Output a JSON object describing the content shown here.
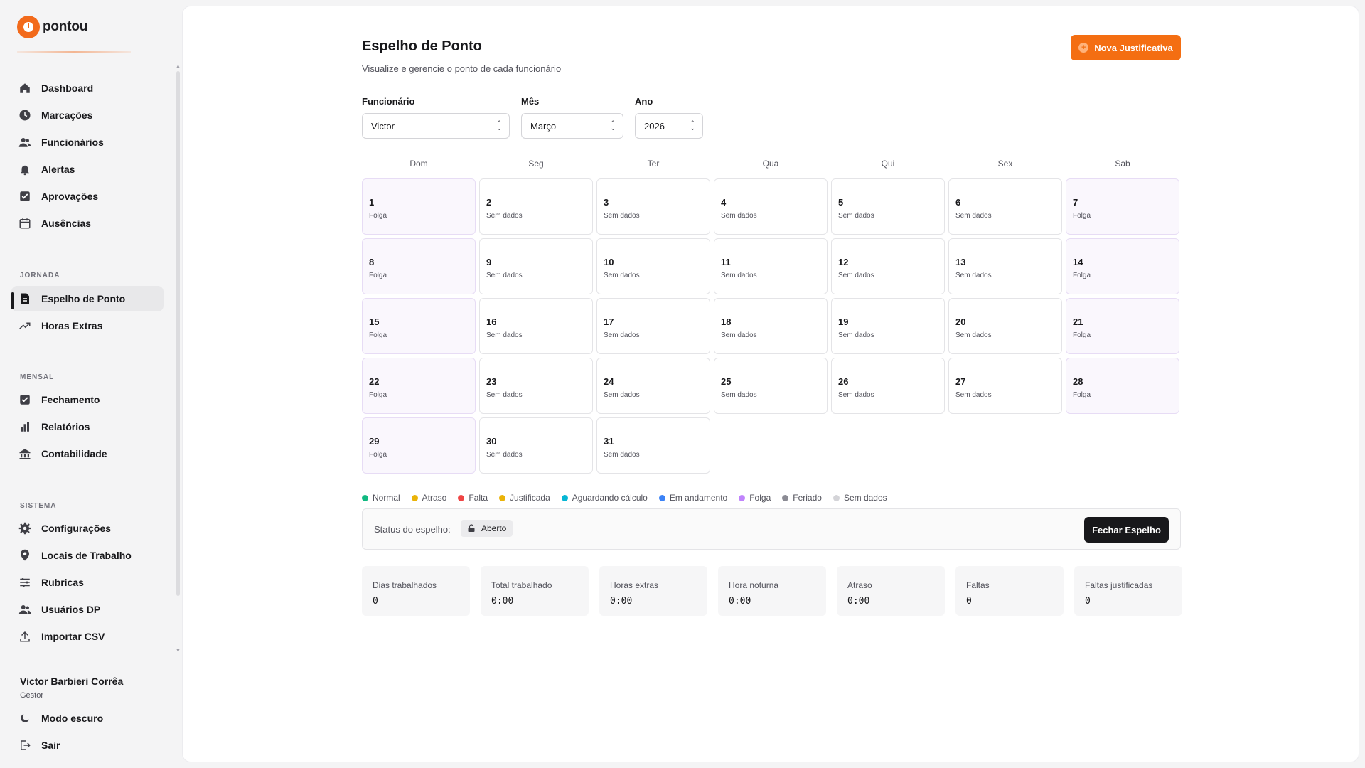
{
  "brand": {
    "name": "pontou",
    "accent": "#f46e12"
  },
  "sidebar": {
    "main_items": [
      {
        "label": "Dashboard",
        "icon": "home-icon"
      },
      {
        "label": "Marcações",
        "icon": "clock-icon"
      },
      {
        "label": "Funcionários",
        "icon": "users-icon"
      },
      {
        "label": "Alertas",
        "icon": "bell-icon"
      },
      {
        "label": "Aprovações",
        "icon": "check-square-icon"
      },
      {
        "label": "Ausências",
        "icon": "calendar-icon"
      }
    ],
    "sections": [
      {
        "label": "JORNADA",
        "items": [
          {
            "label": "Espelho de Ponto",
            "icon": "file-icon",
            "active": true
          },
          {
            "label": "Horas Extras",
            "icon": "trending-up-icon"
          }
        ]
      },
      {
        "label": "MENSAL",
        "items": [
          {
            "label": "Fechamento",
            "icon": "check-square-icon"
          },
          {
            "label": "Relatórios",
            "icon": "bar-chart-icon"
          },
          {
            "label": "Contabilidade",
            "icon": "building-icon"
          }
        ]
      },
      {
        "label": "SISTEMA",
        "items": [
          {
            "label": "Configurações",
            "icon": "gear-icon"
          },
          {
            "label": "Locais de Trabalho",
            "icon": "map-pin-icon"
          },
          {
            "label": "Rubricas",
            "icon": "sliders-icon"
          },
          {
            "label": "Usuários DP",
            "icon": "users-icon"
          },
          {
            "label": "Importar CSV",
            "icon": "upload-icon"
          }
        ]
      }
    ],
    "user": {
      "name": "Victor Barbieri Corrêa",
      "role": "Gestor"
    },
    "footer_items": [
      {
        "label": "Modo escuro",
        "icon": "moon-icon"
      },
      {
        "label": "Sair",
        "icon": "logout-icon"
      }
    ]
  },
  "header": {
    "title": "Espelho de Ponto",
    "subtitle": "Visualize e gerencie o ponto de cada funcionário",
    "new_button": "Nova Justificativa"
  },
  "filters": {
    "employee": {
      "label": "Funcionário",
      "value": "Victor"
    },
    "month": {
      "label": "Mês",
      "value": "Março"
    },
    "year": {
      "label": "Ano",
      "value": "2026"
    }
  },
  "calendar": {
    "weekdays": [
      "Dom",
      "Seg",
      "Ter",
      "Qua",
      "Qui",
      "Sex",
      "Sab"
    ],
    "days": [
      {
        "n": "1",
        "s": "Folga"
      },
      {
        "n": "2",
        "s": "Sem dados"
      },
      {
        "n": "3",
        "s": "Sem dados"
      },
      {
        "n": "4",
        "s": "Sem dados"
      },
      {
        "n": "5",
        "s": "Sem dados"
      },
      {
        "n": "6",
        "s": "Sem dados"
      },
      {
        "n": "7",
        "s": "Folga"
      },
      {
        "n": "8",
        "s": "Folga"
      },
      {
        "n": "9",
        "s": "Sem dados"
      },
      {
        "n": "10",
        "s": "Sem dados"
      },
      {
        "n": "11",
        "s": "Sem dados"
      },
      {
        "n": "12",
        "s": "Sem dados"
      },
      {
        "n": "13",
        "s": "Sem dados"
      },
      {
        "n": "14",
        "s": "Folga"
      },
      {
        "n": "15",
        "s": "Folga"
      },
      {
        "n": "16",
        "s": "Sem dados"
      },
      {
        "n": "17",
        "s": "Sem dados"
      },
      {
        "n": "18",
        "s": "Sem dados"
      },
      {
        "n": "19",
        "s": "Sem dados"
      },
      {
        "n": "20",
        "s": "Sem dados"
      },
      {
        "n": "21",
        "s": "Folga"
      },
      {
        "n": "22",
        "s": "Folga"
      },
      {
        "n": "23",
        "s": "Sem dados"
      },
      {
        "n": "24",
        "s": "Sem dados"
      },
      {
        "n": "25",
        "s": "Sem dados"
      },
      {
        "n": "26",
        "s": "Sem dados"
      },
      {
        "n": "27",
        "s": "Sem dados"
      },
      {
        "n": "28",
        "s": "Folga"
      },
      {
        "n": "29",
        "s": "Folga"
      },
      {
        "n": "30",
        "s": "Sem dados"
      },
      {
        "n": "31",
        "s": "Sem dados"
      }
    ]
  },
  "legend": [
    {
      "label": "Normal",
      "color": "#10b981"
    },
    {
      "label": "Atraso",
      "color": "#eab308"
    },
    {
      "label": "Falta",
      "color": "#ef4444"
    },
    {
      "label": "Justificada",
      "color": "#eab308"
    },
    {
      "label": "Aguardando cálculo",
      "color": "#06b6d4"
    },
    {
      "label": "Em andamento",
      "color": "#3b82f6"
    },
    {
      "label": "Folga",
      "color": "#c084fc"
    },
    {
      "label": "Feriado",
      "color": "#8b8b94"
    },
    {
      "label": "Sem dados",
      "color": "#d4d4d8"
    }
  ],
  "status": {
    "label": "Status do espelho:",
    "badge": "Aberto",
    "close_button": "Fechar Espelho"
  },
  "stats": [
    {
      "label": "Dias trabalhados",
      "value": "0"
    },
    {
      "label": "Total trabalhado",
      "value": "0:00"
    },
    {
      "label": "Horas extras",
      "value": "0:00"
    },
    {
      "label": "Hora noturna",
      "value": "0:00"
    },
    {
      "label": "Atraso",
      "value": "0:00"
    },
    {
      "label": "Faltas",
      "value": "0"
    },
    {
      "label": "Faltas justificadas",
      "value": "0"
    }
  ]
}
